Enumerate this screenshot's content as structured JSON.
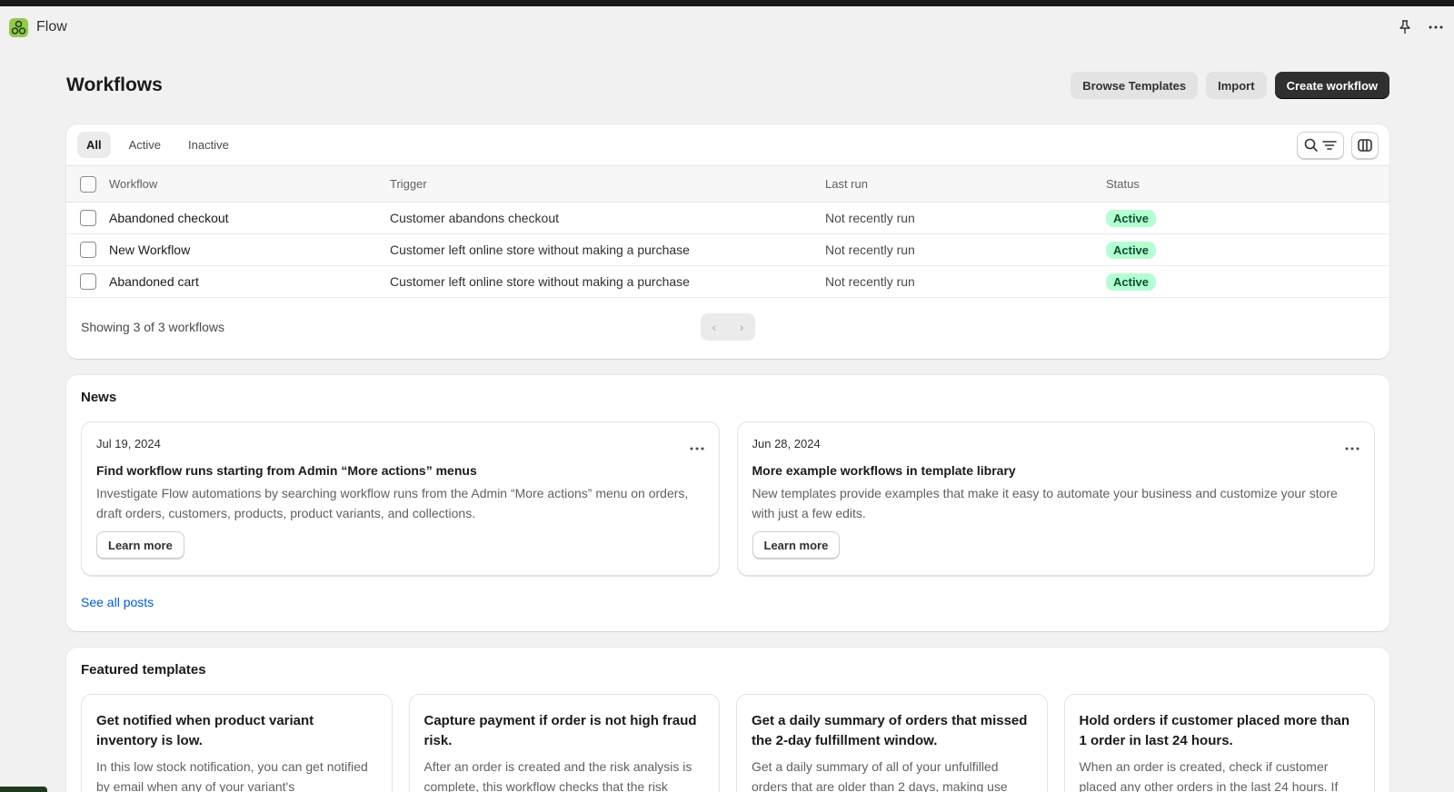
{
  "app": {
    "name": "Flow",
    "logo_color": "#95c94a",
    "icons": [
      "pin-icon",
      "more-horizontal-icon"
    ]
  },
  "page": {
    "title": "Workflows",
    "actions": {
      "browse_templates": "Browse Templates",
      "import": "Import",
      "create_workflow": "Create workflow"
    }
  },
  "workflows": {
    "tabs": [
      "All",
      "Active",
      "Inactive"
    ],
    "selected_tab": "All",
    "columns": {
      "workflow": "Workflow",
      "trigger": "Trigger",
      "last_run": "Last run",
      "status": "Status"
    },
    "rows": [
      {
        "name": "Abandoned checkout",
        "trigger": "Customer abandons checkout",
        "last_run": "Not recently run",
        "status": "Active"
      },
      {
        "name": "New Workflow",
        "trigger": "Customer left online store without making a purchase",
        "last_run": "Not recently run",
        "status": "Active"
      },
      {
        "name": "Abandoned cart",
        "trigger": "Customer left online store without making a purchase",
        "last_run": "Not recently run",
        "status": "Active"
      }
    ],
    "footer": "Showing 3 of 3 workflows",
    "status_color": "#b4fed2"
  },
  "news": {
    "title": "News",
    "items": [
      {
        "date": "Jul 19, 2024",
        "title": "Find workflow runs starting from Admin “More actions” menus",
        "body": "Investigate Flow automations by searching workflow runs from the Admin “More actions” menu on orders, draft orders, customers, products, product variants, and collections.",
        "cta": "Learn more"
      },
      {
        "date": "Jun 28, 2024",
        "title": "More example workflows in template library",
        "body": "New templates provide examples that make it easy to automate your business and customize your store with just a few edits.",
        "cta": "Learn more"
      }
    ],
    "see_all": "See all posts"
  },
  "featured": {
    "title": "Featured templates",
    "items": [
      {
        "title": "Get notified when product variant inventory is low.",
        "body": "In this low stock notification, you can get notified by email when any of your variant's"
      },
      {
        "title": "Capture payment if order is not high fraud risk.",
        "body": "After an order is created and the risk analysis is complete, this workflow checks that the risk"
      },
      {
        "title": "Get a daily summary of orders that missed the 2-day fulfillment window.",
        "body": "Get a daily summary of all of your unfulfilled orders that are older than 2 days, making use"
      },
      {
        "title": "Hold orders if customer placed more than 1 order in last 24 hours.",
        "body": "When an order is created, check if customer placed any other orders in the last 24 hours. If"
      }
    ]
  }
}
